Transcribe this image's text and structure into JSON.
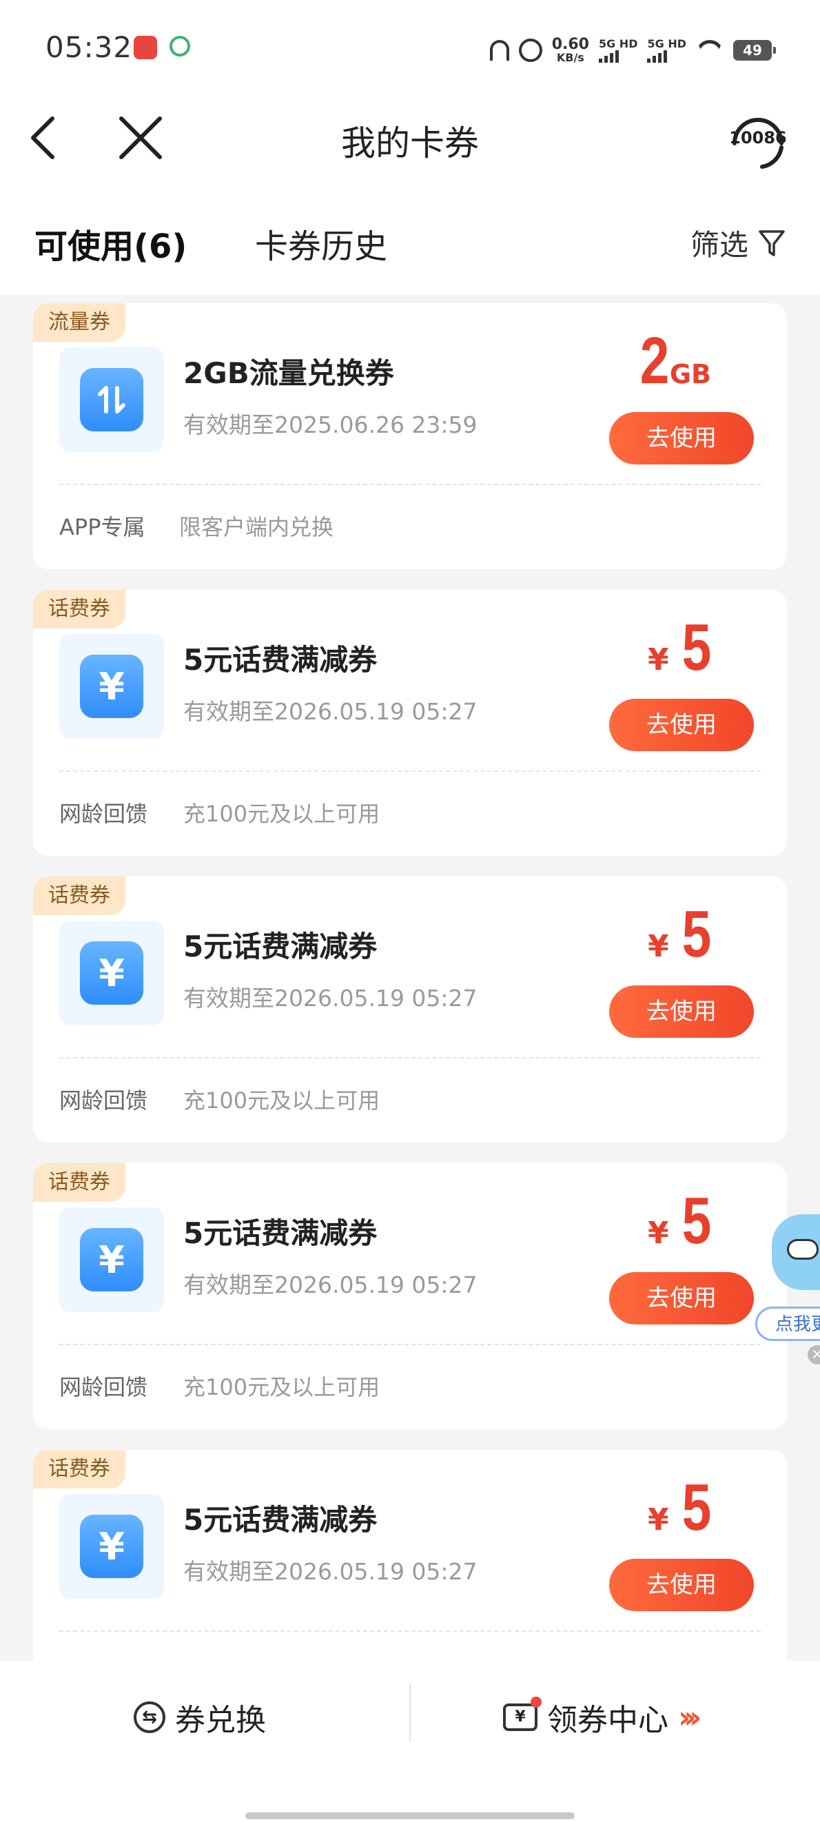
{
  "status_bar": {
    "time": "05:32",
    "net_speed_value": "0.60",
    "net_speed_unit": "KB/s",
    "sim1": "5G HD",
    "sim2": "5G HD",
    "battery": "49"
  },
  "header": {
    "title": "我的卡券",
    "service_label": "10086"
  },
  "tabs": {
    "usable": "可使用(6)",
    "history": "卡券历史",
    "filter": "筛选"
  },
  "cards": [
    {
      "tag": "流量券",
      "icon": "data-transfer-icon",
      "title": "2GB流量兑换券",
      "expiry": "有效期至2025.06.26 23:59",
      "value_prefix": "",
      "value": "2",
      "value_unit": "GB",
      "button": "去使用",
      "label": "APP专属",
      "desc": "限客户端内兑换"
    },
    {
      "tag": "话费券",
      "icon": "yen-icon",
      "title": "5元话费满减券",
      "expiry": "有效期至2026.05.19 05:27",
      "value_prefix": "¥",
      "value": "5",
      "value_unit": "",
      "button": "去使用",
      "label": "网龄回馈",
      "desc": "充100元及以上可用"
    },
    {
      "tag": "话费券",
      "icon": "yen-icon",
      "title": "5元话费满减券",
      "expiry": "有效期至2026.05.19 05:27",
      "value_prefix": "¥",
      "value": "5",
      "value_unit": "",
      "button": "去使用",
      "label": "网龄回馈",
      "desc": "充100元及以上可用"
    },
    {
      "tag": "话费券",
      "icon": "yen-icon",
      "title": "5元话费满减券",
      "expiry": "有效期至2026.05.19 05:27",
      "value_prefix": "¥",
      "value": "5",
      "value_unit": "",
      "button": "去使用",
      "label": "网龄回馈",
      "desc": "充100元及以上可用"
    },
    {
      "tag": "话费券",
      "icon": "yen-icon",
      "title": "5元话费满减券",
      "expiry": "有效期至2026.05.19 05:27",
      "value_prefix": "¥",
      "value": "5",
      "value_unit": "",
      "button": "去使用",
      "label": "",
      "desc": ""
    }
  ],
  "floating": {
    "label": "点我更"
  },
  "bottom_bar": {
    "exchange": "券兑换",
    "exchange_icon_glyph": "⇆",
    "center": "领券中心",
    "center_icon_glyph": "¥",
    "arrows": "›››"
  },
  "colors": {
    "accent": "#e8402c",
    "button": "#f1462a",
    "tag_bg": "#fde7c8",
    "icon_blue": "#2f8dfb"
  }
}
